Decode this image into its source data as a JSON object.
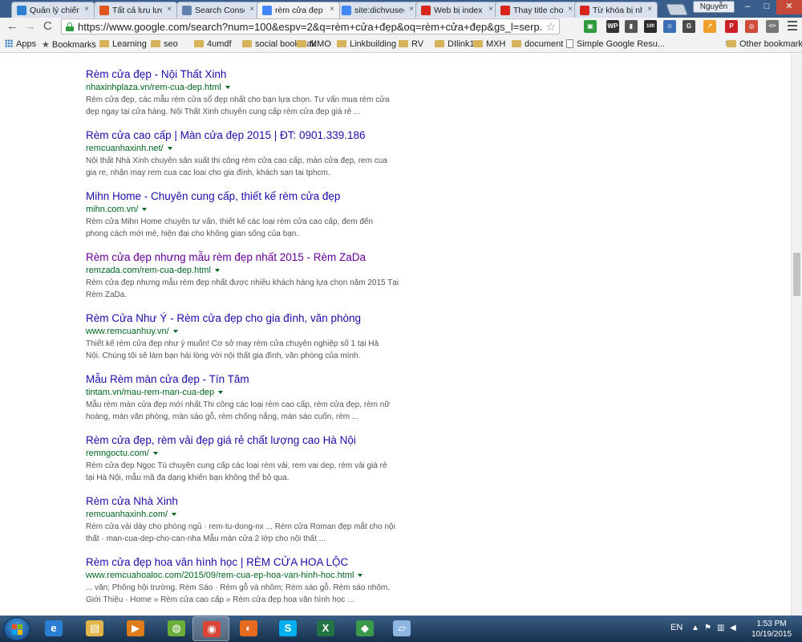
{
  "tabs": [
    {
      "label": "Quản lý chiến",
      "favicon_color": "#2f7fd1",
      "active": false
    },
    {
      "label": "Tất cả lưu lượ",
      "favicon_color": "#e0561c",
      "active": false
    },
    {
      "label": "Search Consol",
      "favicon_color": "#5f7fae",
      "active": false
    },
    {
      "label": "rèm cửa đẹp -",
      "favicon_color": "#4285f4",
      "active": true
    },
    {
      "label": "site:dichvusec",
      "favicon_color": "#4285f4",
      "active": false
    },
    {
      "label": "Web bị index",
      "favicon_color": "#d9261c",
      "active": false
    },
    {
      "label": "Thay title cho",
      "favicon_color": "#d9261c",
      "active": false
    },
    {
      "label": "Từ khóa bị nhi",
      "favicon_color": "#d9261c",
      "active": false
    }
  ],
  "profile_name": "Nguyễn",
  "window_controls": {
    "minimize": "–",
    "maximize": "□",
    "close": "✕"
  },
  "toolbar": {
    "back": "←",
    "forward": "→",
    "reload": "C",
    "url": "https://www.google.com/search?num=100&espv=2&q=rèm+cửa+đẹp&oq=rèm+cửa+đẹp&gs_l=serp.3...",
    "star": "☆"
  },
  "extensions": [
    {
      "name": "ext-green-icon",
      "color": "#2e9c3e",
      "text": "▣"
    },
    {
      "name": "ext-wp-icon",
      "color": "#333333",
      "text": "WP"
    },
    {
      "name": "ext-phone-icon",
      "color": "#555555",
      "text": "▮"
    },
    {
      "name": "ext-100-icon",
      "color": "#2b2b2b",
      "text": "100"
    },
    {
      "name": "ext-person-icon",
      "color": "#3a6fb5",
      "text": "☺"
    },
    {
      "name": "ext-g-icon",
      "color": "#4a4a4a",
      "text": "G"
    },
    {
      "name": "ext-chart-icon",
      "color": "#f0a02a",
      "text": "↗"
    },
    {
      "name": "ext-pinterest-icon",
      "color": "#cb2027",
      "text": "P"
    },
    {
      "name": "ext-globe-icon",
      "color": "#d04a3a",
      "text": "◎"
    },
    {
      "name": "ext-code-icon",
      "color": "#777777",
      "text": "</>"
    },
    {
      "name": "ext-tool-icon",
      "color": "#666666",
      "text": "✎"
    },
    {
      "name": "ext-check-icon",
      "color": "#3a8f3a",
      "text": "✓"
    }
  ],
  "bookmarks": {
    "apps": "Apps",
    "bookmarks_label": "Bookmarks",
    "folders": [
      "Learning",
      "seo",
      "4umdf",
      "social bookmak",
      "MMO",
      "Linkbuilding",
      "RV",
      "DIlink1",
      "MXH",
      "document"
    ],
    "page": "Simple Google Resu...",
    "overflow": "»",
    "other": "Other bookmarks"
  },
  "results": [
    {
      "title": "Rèm cửa đẹp - Nội Thất Xinh",
      "url": "nhaxinhplaza.vn/rem-cua-dep.html",
      "snippet_1": "Rèm cửa đẹp, các mẫu rèm cửa sổ đẹp nhất cho bạn lựa chọn. Tư vấn mua rèm cửa",
      "snippet_2": "đẹp ngay tại cửa hàng. Nội Thất Xinh chuyên cung cấp rèm cửa đẹp giá rẻ ...",
      "visited": false
    },
    {
      "title": "Rèm cửa cao cấp | Màn cửa đẹp 2015 | ĐT: 0901.339.186",
      "url": "remcuanhaxinh.net/",
      "snippet_1": "Nội thất Nhà Xinh chuyên sản xuất thi công rèm cửa cao cấp, màn cửa đẹp, rem cua",
      "snippet_2": "gia re, nhận may rem cua cac loai cho gia đình, khách sạn tai tphcm.",
      "visited": false
    },
    {
      "title": "Mihn Home - Chuyên cung cấp, thiết kế rèm cửa đẹp",
      "url": "mihn.com.vn/",
      "snippet_1": "Rèm cửa Mihn Home chuyên tư vấn, thiết kế các loại rèm cửa cao cấp, đem đến",
      "snippet_2": "phong cách mới mẻ, hiện đại cho không gian sống của bạn.",
      "visited": false
    },
    {
      "title": "Rèm cửa đẹp nhưng mẫu rèm đẹp nhất 2015 - Rèm ZaDa",
      "url": "remzada.com/rem-cua-dep.html",
      "snippet_1": "Rèm cửa đẹp nhưng mẫu rèm đẹp nhất được nhiều khách hàng lựa chọn năm 2015 Tại",
      "snippet_2": "Rèm ZaDa.",
      "visited": true
    },
    {
      "title": "Rèm Cửa Như Ý - Rèm cửa đẹp cho gia đình, văn phòng",
      "url": "www.remcuanhuy.vn/",
      "snippet_1": "Thiết kế rèm cửa đẹp như ý muốn! Cơ sở may rèm cửa chuyên nghiệp số 1 tại Hà",
      "snippet_2": "Nội. Chúng tôi sẽ làm bạn hài lòng với nội thất gia đình, văn phòng của mình.",
      "visited": false
    },
    {
      "title": "Mẫu Rèm màn cửa đẹp - Tín Tâm",
      "url": "tintam.vn/mau-rem-man-cua-dep",
      "snippet_1": "Mẫu rèm màn cửa đẹp mới nhất.Thi công các loại rèm cao cấp, rèm cửa đẹp, rèm nữ",
      "snippet_2": "hoàng, màn văn phòng, màn sáo gỗ, rèm chống nắng, màn sáo cuốn, rèm ...",
      "visited": false
    },
    {
      "title": "Rèm cửa đẹp, rèm vải đẹp giá rẻ chất lượng cao Hà Nội",
      "url": "remngoctu.com/",
      "snippet_1": "Rèm cửa đẹp Ngọc Tú chuyên cung cấp các loại rèm vải, rem vai dep, rèm vải giá rẻ",
      "snippet_2": "tại Hà Nội, mẫu mã đa dạng khiến bạn không thể bỏ qua.",
      "visited": false
    },
    {
      "title": "Rèm cửa Nhà Xinh",
      "url": "remcuanhaxinh.com/",
      "snippet_1": "Rèm cửa vải dày cho phòng ngủ · rem-tu-dong-nx ... Rèm cửa Roman đẹp mắt cho nội",
      "snippet_2": "thất · man-cua-dep-cho-can-nha Mẫu màn cửa 2 lớp cho nội thất ...",
      "visited": false
    },
    {
      "title": "Rèm cửa đẹp hoa văn hình học | RÈM CỬA HOA LỘC",
      "url": "www.remcuahoaloc.com/2015/09/rem-cua-ep-hoa-van-hinh-hoc.html",
      "snippet_1": "... văn; Phông hội trường. Rèm Sáo · Rèm gỗ và nhôm; Rèm sáo gỗ. Rèm sáo nhôm.",
      "snippet_2": "Giới Thiệu · Home » Rèm cửa cao cấp » Rèm cửa đẹp hoa văn hình học ...",
      "visited": false
    }
  ],
  "taskbar": {
    "apps": [
      {
        "name": "ie-taskbar-icon",
        "color": "#2a7fd4",
        "text": "e",
        "active": false
      },
      {
        "name": "explorer-taskbar-icon",
        "color": "#e1b54a",
        "text": "▤",
        "active": false
      },
      {
        "name": "media-player-taskbar-icon",
        "color": "#e07b1a",
        "text": "▶",
        "active": false
      },
      {
        "name": "coccoc-taskbar-icon",
        "color": "#6cae3a",
        "text": "◍",
        "active": false
      },
      {
        "name": "chrome-taskbar-icon",
        "color": "#db4437",
        "text": "◉",
        "active": true
      },
      {
        "name": "firefox-taskbar-icon",
        "color": "#e66a1f",
        "text": "◐",
        "active": false
      },
      {
        "name": "skype-taskbar-icon",
        "color": "#00aff0",
        "text": "S",
        "active": false
      },
      {
        "name": "excel-taskbar-icon",
        "color": "#217346",
        "text": "X",
        "active": false
      },
      {
        "name": "network-taskbar-icon",
        "color": "#3a9a4a",
        "text": "◆",
        "active": false
      },
      {
        "name": "notes-taskbar-icon",
        "color": "#8fb6e0",
        "text": "▱",
        "active": false
      }
    ],
    "language": "EN",
    "time": "1:53 PM",
    "date": "10/19/2015"
  }
}
